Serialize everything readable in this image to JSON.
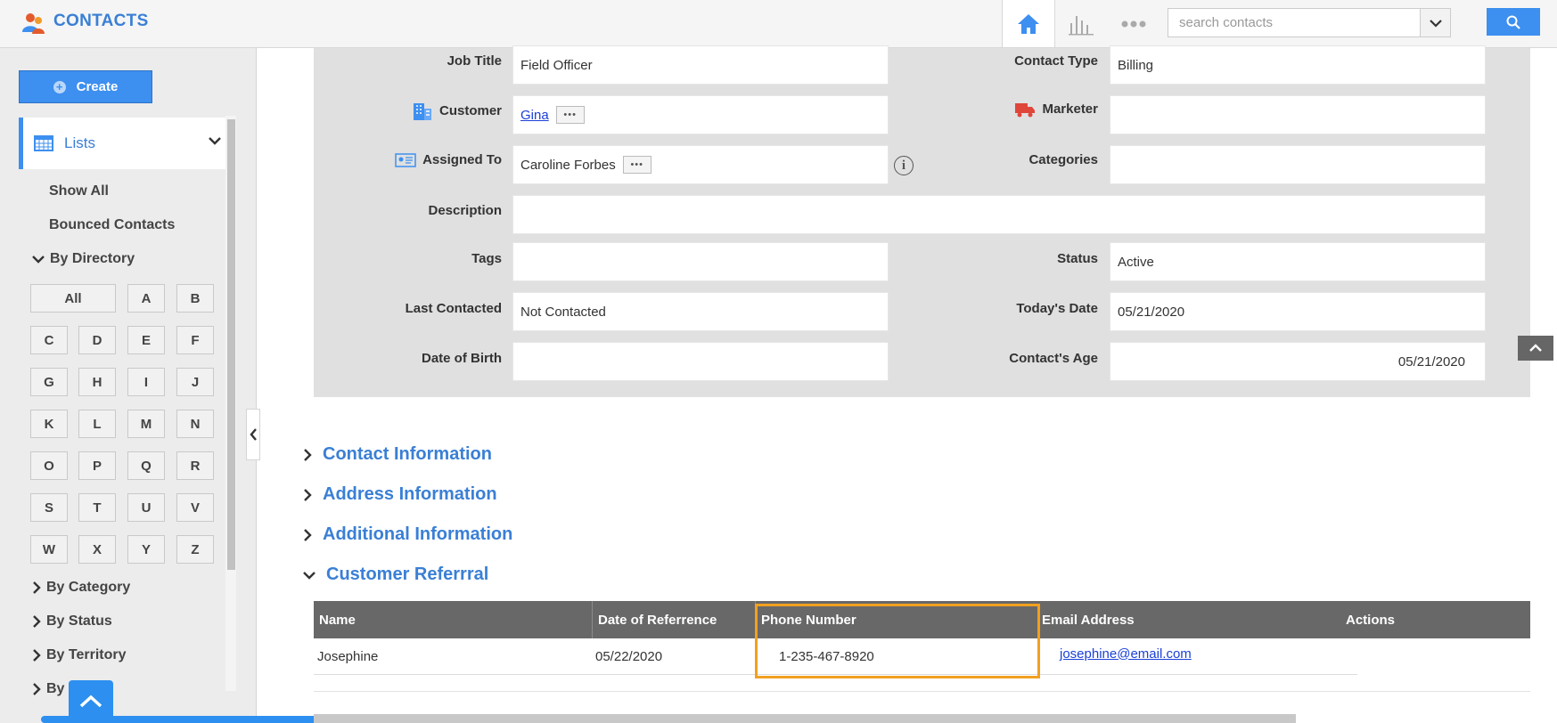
{
  "app": {
    "title": "CONTACTS"
  },
  "search": {
    "placeholder": "search contacts"
  },
  "sidebar": {
    "create_label": "Create",
    "lists_label": "Lists",
    "show_all": "Show All",
    "bounced": "Bounced Contacts",
    "by_directory": "By Directory",
    "letters": [
      "All",
      "A",
      "B",
      "C",
      "D",
      "E",
      "F",
      "G",
      "H",
      "I",
      "J",
      "K",
      "L",
      "M",
      "N",
      "O",
      "P",
      "Q",
      "R",
      "S",
      "T",
      "U",
      "V",
      "W",
      "X",
      "Y",
      "Z"
    ],
    "by_category": "By Category",
    "by_status": "By Status",
    "by_territory": "By Territory",
    "by_more": "By"
  },
  "form": {
    "job_title": {
      "label": "Job Title",
      "value": "Field Officer"
    },
    "contact_type": {
      "label": "Contact Type",
      "value": "Billing"
    },
    "customer": {
      "label": "Customer",
      "value": "Gina"
    },
    "marketer": {
      "label": "Marketer",
      "value": ""
    },
    "assigned_to": {
      "label": "Assigned To",
      "value": "Caroline Forbes"
    },
    "categories": {
      "label": "Categories",
      "value": ""
    },
    "description": {
      "label": "Description",
      "value": ""
    },
    "tags": {
      "label": "Tags",
      "value": ""
    },
    "status": {
      "label": "Status",
      "value": "Active"
    },
    "last_contacted": {
      "label": "Last Contacted",
      "value": "Not Contacted"
    },
    "todays_date": {
      "label": "Today's Date",
      "value": "05/21/2020"
    },
    "date_of_birth": {
      "label": "Date of Birth",
      "value": ""
    },
    "contacts_age": {
      "label": "Contact's Age",
      "value": "05/21/2020"
    }
  },
  "sections": {
    "contact_info": "Contact Information",
    "address_info": "Address Information",
    "additional_info": "Additional Information",
    "customer_referral": "Customer Referrral"
  },
  "referral_table": {
    "headers": {
      "name": "Name",
      "date": "Date of Referrence",
      "phone": "Phone Number",
      "email": "Email Address",
      "actions": "Actions"
    },
    "rows": [
      {
        "name": "Josephine",
        "date": "05/22/2020",
        "phone": "1-235-467-8920",
        "email": "josephine@email.com"
      }
    ]
  },
  "colors": {
    "accent": "#3d8ff0",
    "highlight": "#f2a020",
    "table_header": "#686868"
  }
}
